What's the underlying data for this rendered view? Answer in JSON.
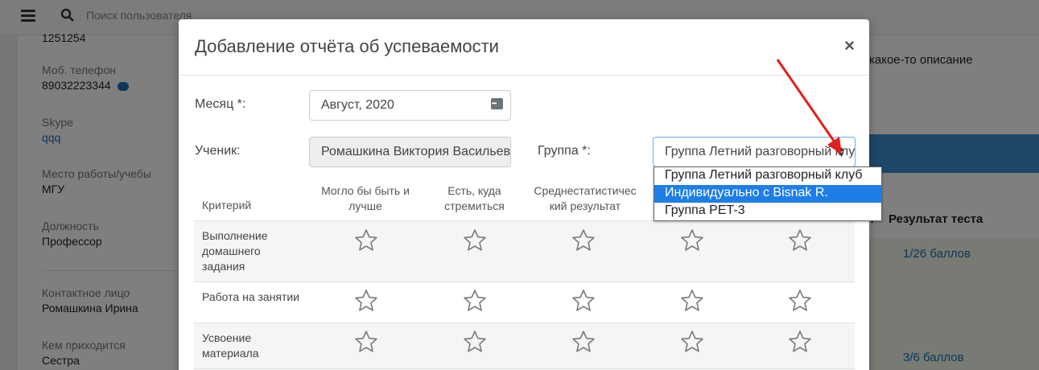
{
  "background": {
    "search_placeholder": "Поиск пользователя",
    "partial_top_value": "1251254",
    "fields": [
      {
        "label": "Моб. телефон",
        "value": "89032223344"
      },
      {
        "label": "Skype",
        "value": "qqq"
      },
      {
        "label": "Место работы/учебы",
        "value": "МГУ"
      },
      {
        "label": "Должность",
        "value": "Профессор"
      },
      {
        "label": "Контактное лицо",
        "value": "Ромашкина Ирина"
      },
      {
        "label": "Кем приходится",
        "value": "Сестра"
      }
    ],
    "right": {
      "description": "какое-то описание",
      "column_partial": "т",
      "column_header": "Результат теста",
      "scores": [
        "1/26 баллов",
        "3/6 баллов"
      ]
    }
  },
  "modal": {
    "title": "Добавление отчёта об успеваемости",
    "close": "×",
    "month_label": "Месяц *:",
    "month_value": "Август, 2020",
    "student_label": "Ученик:",
    "student_value": "Ромашкина Виктория Васильевна",
    "group_label": "Группа *:",
    "group_value": "Группа Летний разговорный клуб",
    "group_options": [
      "Группа Летний разговорный клуб",
      "Индивидуально с Bisnak R.",
      "Группа PET-3"
    ],
    "group_highlighted_index": 1,
    "criteria_header": "Критерий",
    "rating_headers": [
      "Могло бы быть и лучше",
      "Есть, куда стремиться",
      "Среднестатистический результат",
      "",
      ""
    ],
    "criteria": [
      "Выполнение домашнего задания",
      "Работа на занятии",
      "Усвоение материала"
    ]
  },
  "colors": {
    "accent": "#1e7ee8",
    "arrow": "#e0201b",
    "link": "#1a6fb5"
  }
}
